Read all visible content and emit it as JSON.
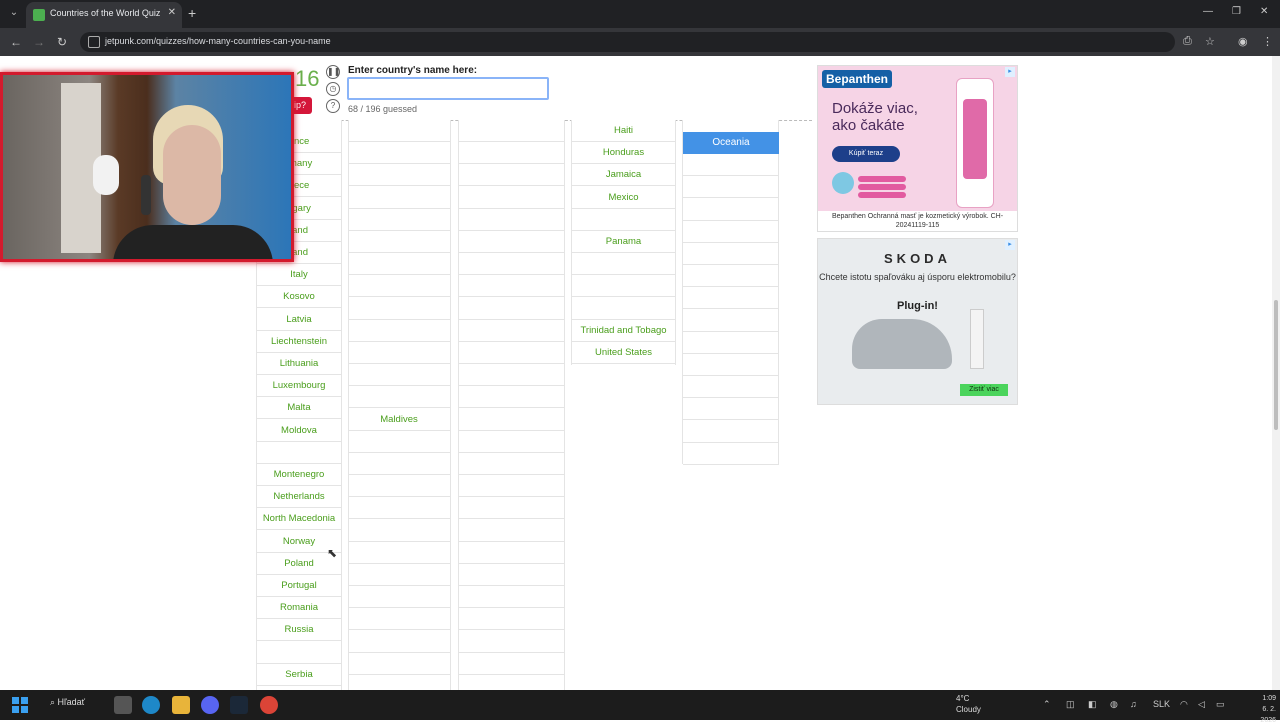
{
  "browser": {
    "tab_title": "Countries of the World Quiz",
    "tab_close": "✕",
    "new_tab": "+",
    "url": "jetpunk.com/quizzes/how-many-countries-can-you-name"
  },
  "quiz": {
    "score_partial": "16",
    "input_label": "Enter country's name here:",
    "input_value": "",
    "guessed_text": "68 / 196 guessed",
    "give_up_partial": "ip?",
    "continent_header": "Oceania"
  },
  "columns": {
    "europe": [
      {
        "slot": 0,
        "text": "ance"
      },
      {
        "slot": 1,
        "text": "rmany"
      },
      {
        "slot": 2,
        "text": "eece"
      },
      {
        "slot": 3,
        "text": "ngary"
      },
      {
        "slot": 4,
        "text": "land"
      },
      {
        "slot": 5,
        "text": "land"
      },
      {
        "slot": 6,
        "text": "Italy"
      },
      {
        "slot": 7,
        "text": "Kosovo"
      },
      {
        "slot": 8,
        "text": "Latvia"
      },
      {
        "slot": 9,
        "text": "Liechtenstein"
      },
      {
        "slot": 10,
        "text": "Lithuania"
      },
      {
        "slot": 11,
        "text": "Luxembourg"
      },
      {
        "slot": 12,
        "text": "Malta"
      },
      {
        "slot": 13,
        "text": "Moldova"
      },
      {
        "slot": 14,
        "text": ""
      },
      {
        "slot": 15,
        "text": "Montenegro"
      },
      {
        "slot": 16,
        "text": "Netherlands"
      },
      {
        "slot": 17,
        "text": "North Macedonia"
      },
      {
        "slot": 18,
        "text": "Norway"
      },
      {
        "slot": 19,
        "text": "Poland"
      },
      {
        "slot": 20,
        "text": "Portugal"
      },
      {
        "slot": 21,
        "text": "Romania"
      },
      {
        "slot": 22,
        "text": "Russia"
      },
      {
        "slot": 23,
        "text": ""
      },
      {
        "slot": 24,
        "text": "Serbia"
      }
    ],
    "asia": [
      {
        "slot": 13,
        "text": "Maldives"
      }
    ],
    "north_america": [
      {
        "slot": 0,
        "text": "Haiti"
      },
      {
        "slot": 1,
        "text": "Honduras"
      },
      {
        "slot": 2,
        "text": "Jamaica"
      },
      {
        "slot": 3,
        "text": "Mexico"
      },
      {
        "slot": 4,
        "text": ""
      },
      {
        "slot": 5,
        "text": "Panama"
      },
      {
        "slot": 6,
        "text": ""
      },
      {
        "slot": 7,
        "text": ""
      },
      {
        "slot": 8,
        "text": ""
      },
      {
        "slot": 9,
        "text": "Trinidad and Tobago"
      },
      {
        "slot": 10,
        "text": "United States"
      }
    ]
  },
  "ads": {
    "bepanthen": {
      "brand": "Bepanthen",
      "headline": "Dokáže viac, ako čakáte",
      "cta": "Kúpiť teraz",
      "caption": "Bepanthen Ochranná masť je kozmetický výrobok. CH-20241119-115"
    },
    "skoda": {
      "logo": "SKODA",
      "sub": "Chcete istotu spaľováku aj úsporu elektromobilu?",
      "headline": "Plug-in!",
      "cta": "Zistiť viac"
    }
  },
  "taskbar": {
    "search": "Hľadať",
    "temperature": "4°C",
    "weather": "Cloudy",
    "lang": "SLK",
    "time": "1:09",
    "date": "6. 2. 2026"
  },
  "colors": {
    "accent_green": "#4a9e1c",
    "oceania_blue": "#4392e6",
    "giveup_red": "#d4173a",
    "webcam_border": "#d31a2d"
  }
}
